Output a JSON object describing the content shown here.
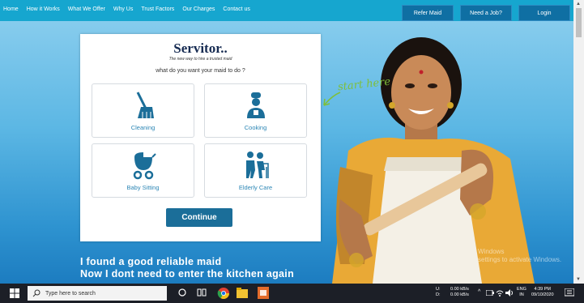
{
  "nav": {
    "items": [
      "Home",
      "How it Works",
      "What We Offer",
      "Why Us",
      "Trust Factors",
      "Our Charges",
      "Contact us"
    ]
  },
  "buttons": {
    "refer": "Refer Maid",
    "need_job": "Need a Job?",
    "login": "Login"
  },
  "card": {
    "brand": "Servitor..",
    "tagline": "The new way to hire a trusted maid",
    "question": "what do you want your maid to do ?",
    "options": [
      {
        "label": "Cleaning"
      },
      {
        "label": "Cooking"
      },
      {
        "label": "Baby Sitting"
      },
      {
        "label": "Elderly Care"
      }
    ],
    "continue": "Continue"
  },
  "start_here": "start here",
  "caption": {
    "line1": "I found a good reliable maid",
    "line2": "Now I dont need to enter the kitchen again"
  },
  "watermark": {
    "line1": "Windows",
    "line2": "settings to activate Windows."
  },
  "taskbar": {
    "search_placeholder": "Type here to search",
    "net_u": "U:",
    "net_d": "D:",
    "net_u_val": "0.00 kB/s",
    "net_d_val": "0.00 kB/s",
    "lang1": "ENG",
    "lang2": "IN",
    "time": "4:39 PM",
    "date": "09/10/2020"
  },
  "colors": {
    "nav_bg": "#16a6cf",
    "nav_button": "#0f6fa3",
    "continue": "#1b6e99",
    "icon": "#1b6e99"
  }
}
